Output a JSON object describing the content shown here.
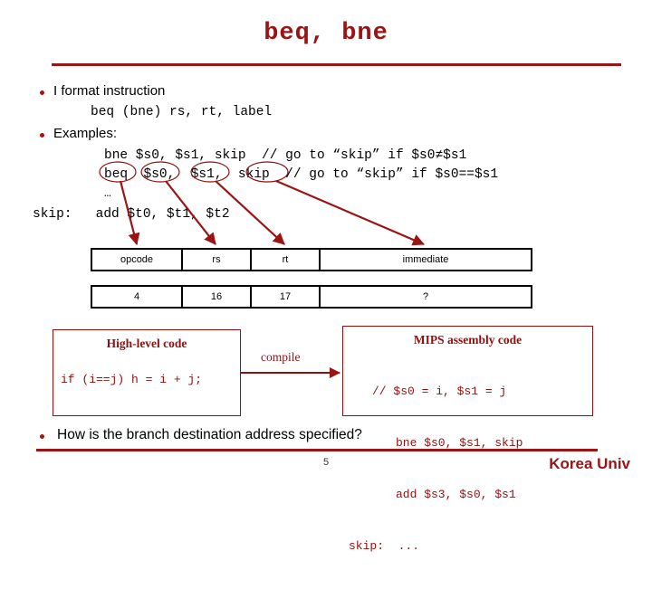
{
  "slide": {
    "title": "beq, bne",
    "page_number": "5",
    "organization": "Korea Univ",
    "accent_color": "#9b1414",
    "box_color": "#8f1010"
  },
  "bullets": {
    "iformat": "I format instruction",
    "examples": "Examples:",
    "question": "How is the branch destination address specified?"
  },
  "code_lines": {
    "iformat_syntax": "beq (bne) rs, rt, label",
    "bne_example": "bne $s0, $s1, skip  // go to “skip” if $s0≠$s1",
    "beq_example": "beq  $s0,  $s1,  skip  // go to “skip” if $s0==$s1",
    "ellipsis": "…",
    "skip_label": "skip:   add $t0, $t1, $t2"
  },
  "instruction_format": {
    "field_headers": [
      "opcode",
      "rs",
      "rt",
      "immediate"
    ],
    "field_values": [
      "4",
      "16",
      "17",
      "?"
    ]
  },
  "annotations": {
    "circled_tokens": [
      "beq",
      "$s0",
      "$s1",
      "skip"
    ],
    "arrow_targets": [
      "opcode",
      "rs",
      "rt",
      "immediate"
    ]
  },
  "high_level_box": {
    "heading": "High-level code",
    "code": "if (i==j) h = i + j;"
  },
  "compile": {
    "label": "compile"
  },
  "mips_box": {
    "heading": "MIPS assembly code",
    "lines": [
      "// $s0 = i, $s1 = j",
      "bne $s0, $s1, skip",
      "add $s3, $s0, $s1",
      "skip:  ..."
    ]
  }
}
